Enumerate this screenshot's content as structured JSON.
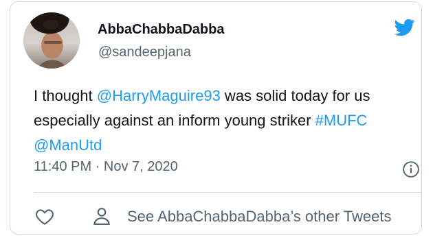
{
  "tweet": {
    "author_name": "AbbaChabbaDabba",
    "handle": "@sandeepjana",
    "text_parts": {
      "part1": "I thought ",
      "mention1": "@HarryMaguire93",
      "part2": " was solid today for us especially against an inform young striker ",
      "hashtag": "#MUFC",
      "space": " ",
      "mention2": "@ManUtd"
    },
    "time": "11:40 PM",
    "separator": " · ",
    "date": "Nov 7, 2020",
    "footer": {
      "see_more": "See AbbaChabbaDabba’s other Tweets"
    }
  },
  "icons": {
    "brand": "twitter-bird-icon",
    "info": "info-icon",
    "like": "heart-icon",
    "profile": "person-icon"
  },
  "colors": {
    "accent": "#1d9bf0",
    "text": "#0f1419",
    "secondary": "#536471",
    "border": "#cfd9de"
  }
}
